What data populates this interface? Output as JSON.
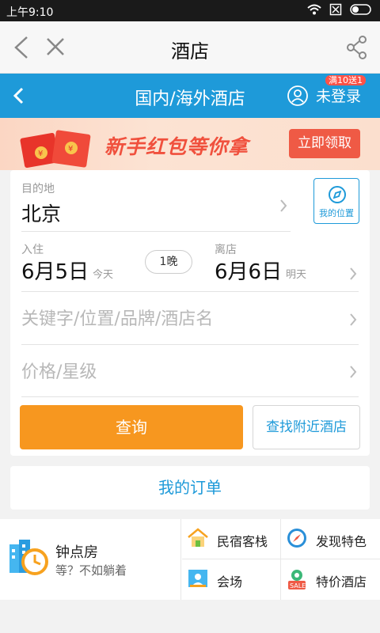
{
  "status_bar": {
    "time": "上午9:10"
  },
  "titlebar": {
    "title": "酒店"
  },
  "bluebar": {
    "title": "国内/海外酒店",
    "login_label": "未登录",
    "promo_badge": "满10送1"
  },
  "banner": {
    "text": "新手红包等你拿",
    "claim_button": "立即领取"
  },
  "search_card": {
    "destination_label": "目的地",
    "destination_value": "北京",
    "my_location_label": "我的位置",
    "checkin_label": "入住",
    "checkin_date": "6月5日",
    "checkin_sub": "今天",
    "nights": "1晚",
    "checkout_label": "离店",
    "checkout_date": "6月6日",
    "checkout_sub": "明天",
    "keyword_placeholder": "关键字/位置/品牌/酒店名",
    "price_placeholder": "价格/星级",
    "search_button": "查询",
    "nearby_button": "查找附近酒店"
  },
  "orders": {
    "label": "我的订单"
  },
  "bottom": {
    "hourly_title": "钟点房",
    "hourly_sub": "等？不如躺着",
    "items": [
      {
        "label": "民宿客栈",
        "icon": "house-icon"
      },
      {
        "label": "发现特色",
        "icon": "compass-icon"
      },
      {
        "label": "会场",
        "icon": "venue-icon"
      },
      {
        "label": "特价酒店",
        "icon": "sale-tag-icon"
      }
    ]
  },
  "colors": {
    "primary_blue": "#1e9ad9",
    "orange": "#f7971f",
    "promo_red": "#ef5a45"
  }
}
